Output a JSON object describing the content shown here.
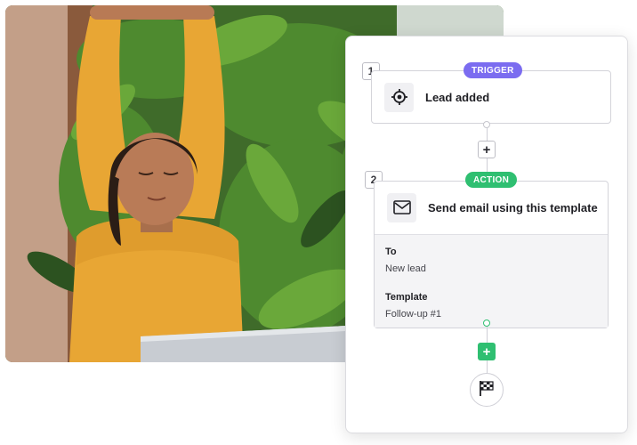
{
  "photo": {
    "description_icon": "person-stretching-photo"
  },
  "workflow": {
    "trigger": {
      "step_number": "1",
      "badge": "TRIGGER",
      "title": "Lead added",
      "icon": "target-icon"
    },
    "action": {
      "step_number": "2",
      "badge": "ACTION",
      "title": "Send email using this template",
      "icon": "mail-icon",
      "fields": [
        {
          "label": "To",
          "value": "New lead"
        },
        {
          "label": "Template",
          "value": "Follow-up #1"
        }
      ]
    },
    "add_step_glyph": "+",
    "finish_icon": "checkered-flag-icon"
  },
  "colors": {
    "trigger": "#7b6cf0",
    "action": "#2fbf71",
    "sweater": "#e8a634"
  }
}
